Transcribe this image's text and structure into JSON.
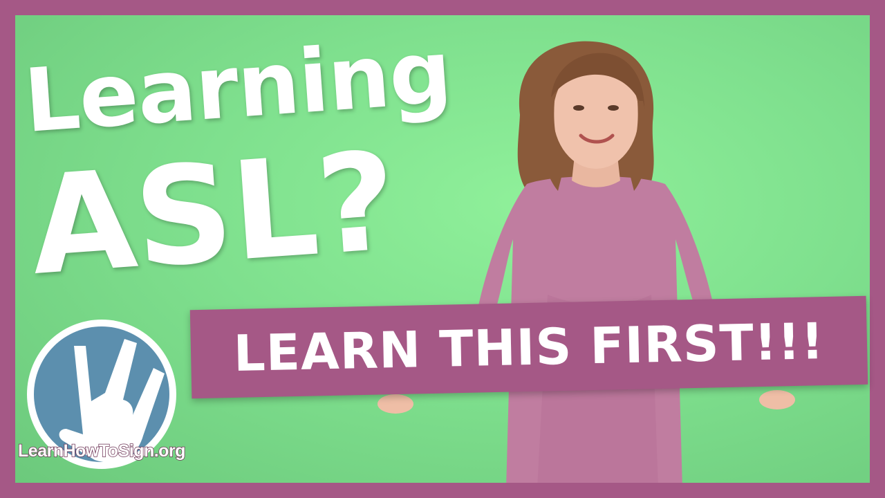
{
  "headline": {
    "line1": "Learning",
    "line2": "ASL?"
  },
  "banner": {
    "text": "LEARN THIS FIRST!!!"
  },
  "logo": {
    "text": "LearnHowToSign.org",
    "icon": "ily-hand-icon"
  },
  "colors": {
    "frame": "#a55886",
    "background": "#86e894",
    "text": "#ffffff",
    "logo_circle": "#5c8fae"
  }
}
